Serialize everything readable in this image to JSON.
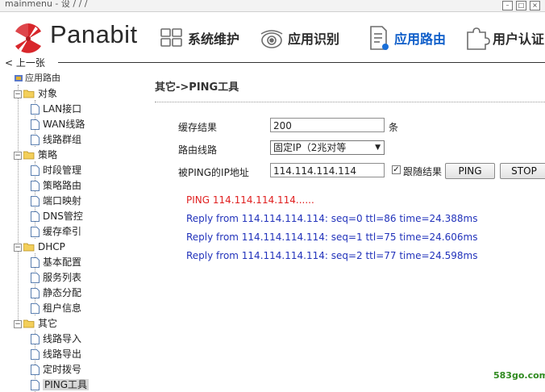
{
  "titlebar": {
    "text": "mainmenu - 设 / / /"
  },
  "brand": {
    "name": "Panabit",
    "logo_colors": [
      "#d8262b",
      "#d8262b",
      "#d8262b"
    ]
  },
  "nav": [
    {
      "label": "系统维护",
      "icon": "sysmaint-grid-icon",
      "active": false
    },
    {
      "label": "应用识别",
      "icon": "camera-recognition-icon",
      "active": false
    },
    {
      "label": "应用路由",
      "icon": "document-routing-icon",
      "active": true
    },
    {
      "label": "用户认证",
      "icon": "puzzle-auth-icon",
      "active": false
    }
  ],
  "back": {
    "label": "< 上一张"
  },
  "tree": {
    "root": "应用路由",
    "groups": [
      {
        "label": "对象",
        "items": [
          "LAN接口",
          "WAN线路",
          "线路群组"
        ]
      },
      {
        "label": "策略",
        "items": [
          "时段管理",
          "策略路由",
          "端口映射",
          "DNS管控",
          "缓存牵引"
        ]
      },
      {
        "label": "DHCP",
        "items": [
          "基本配置",
          "服务列表",
          "静态分配",
          "租户信息"
        ]
      },
      {
        "label": "其它",
        "items": [
          "线路导入",
          "线路导出",
          "定时拨号",
          "PING工具"
        ]
      }
    ],
    "selected": "PING工具"
  },
  "main": {
    "title": "其它->PING工具",
    "cache_label": "缓存结果",
    "cache_value": "200",
    "cache_unit": "条",
    "route_label": "路由线路",
    "route_value": "固定IP（2兆对等",
    "ip_label": "被PING的IP地址",
    "ip_value": "114.114.114.114",
    "follow_label": "跟随结果",
    "follow_checked": true,
    "ping_button": "PING",
    "stop_button": "STOP",
    "output": [
      {
        "text": "PING 114.114.114.114......",
        "color": "#e02020"
      },
      {
        "text": "Reply from 114.114.114.114: seq=0 ttl=86 time=24.388ms",
        "color": "#2233bb"
      },
      {
        "text": "Reply from 114.114.114.114: seq=1 ttl=75 time=24.606ms",
        "color": "#2233bb"
      },
      {
        "text": "Reply from 114.114.114.114: seq=2 ttl=77 time=24.598ms",
        "color": "#2233bb"
      }
    ]
  },
  "watermark": "583go.com"
}
